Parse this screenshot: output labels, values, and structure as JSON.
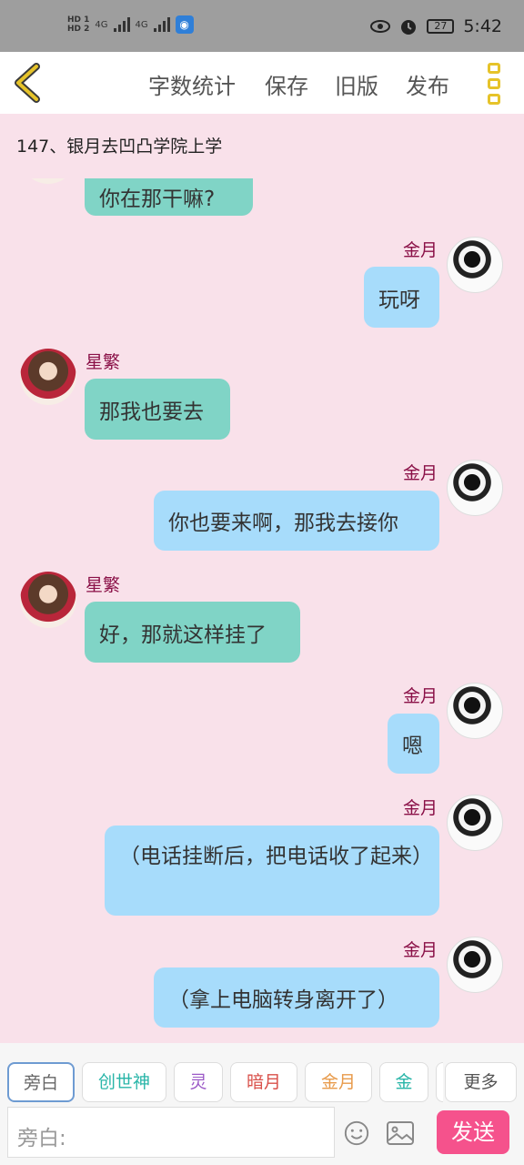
{
  "status": {
    "hd1": "HD 1",
    "hd2": "HD 2",
    "signal1": "4G",
    "signal2": "4G",
    "battery": "27",
    "time": "5:42"
  },
  "toolbar": {
    "word_count": "字数统计",
    "save": "保存",
    "old_version": "旧版",
    "publish": "发布"
  },
  "chapter_title": "147、银月去凹凸学院上学",
  "messages": [
    {
      "side": "left",
      "name": "",
      "text": "你在那干嘛?"
    },
    {
      "side": "right",
      "name": "金月",
      "text": "玩呀"
    },
    {
      "side": "left",
      "name": "星繁",
      "text": "那我也要去"
    },
    {
      "side": "right",
      "name": "金月",
      "text": "你也要来啊，那我去接你"
    },
    {
      "side": "left",
      "name": "星繁",
      "text": "好，那就这样挂了"
    },
    {
      "side": "right",
      "name": "金月",
      "text": "嗯"
    },
    {
      "side": "right",
      "name": "金月",
      "text": "（电话挂断后，把电话收了起来）"
    },
    {
      "side": "right",
      "name": "金月",
      "text": "（拿上电脑转身离开了）"
    }
  ],
  "role_chips": [
    {
      "label": "旁白",
      "color": "#666666"
    },
    {
      "label": "创世神",
      "color": "#28b5a8"
    },
    {
      "label": "灵",
      "color": "#9b59c7"
    },
    {
      "label": "暗月",
      "color": "#d9504a"
    },
    {
      "label": "金月",
      "color": "#e89a4a"
    },
    {
      "label": "金",
      "color": "#28b5a8"
    }
  ],
  "more_label": "更多",
  "input": {
    "placeholder": "旁白:"
  },
  "send_label": "发送",
  "icons": [
    "back-chevron-icon",
    "menu-dots-icon",
    "emoji-icon",
    "image-icon",
    "eye-icon",
    "alarm-icon",
    "wifi-icon"
  ]
}
